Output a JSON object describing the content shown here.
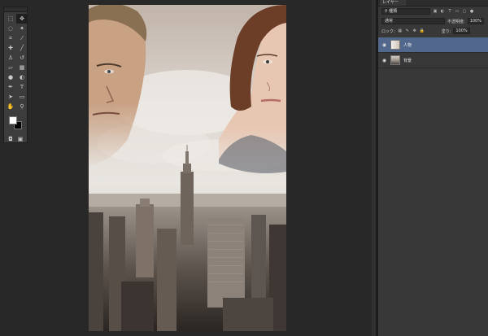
{
  "layers_panel": {
    "tab_label": "レイヤー",
    "filter_kind": "種類",
    "blend_mode": "通常",
    "opacity_label": "不透明度:",
    "opacity_value": "100%",
    "lock_label": "ロック:",
    "fill_label": "塗り:",
    "fill_value": "100%",
    "layers": [
      {
        "name": "人物",
        "selected": true
      },
      {
        "name": "背景",
        "selected": false
      }
    ]
  },
  "colors": {
    "app_background": "#282828",
    "panel_background": "#383838",
    "selection": "#51688c",
    "foreground_swatch": "#ffffff",
    "background_swatch": "#000000"
  },
  "toolbar": {
    "icons": [
      "move-tool",
      "marquee-tool",
      "lasso-tool",
      "magic-wand-tool",
      "crop-tool",
      "eyedropper-tool",
      "healing-tool",
      "brush-tool",
      "clone-stamp-tool",
      "history-brush-tool",
      "eraser-tool",
      "gradient-tool",
      "blur-tool",
      "dodge-tool",
      "pen-tool",
      "type-tool",
      "path-selection-tool",
      "shape-tool",
      "hand-tool",
      "zoom-tool"
    ]
  }
}
